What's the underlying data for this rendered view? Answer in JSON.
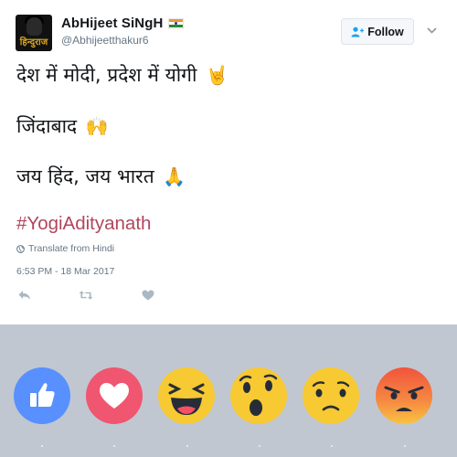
{
  "tweet": {
    "display_name": "AbHijeet SiNgH",
    "handle": "@Abhijeetthakur6",
    "avatar_logo_text": "हिन्दुराज",
    "follow_label": "Follow",
    "lines": [
      "देश में मोदी, प्रदेश में योगी",
      "जिंदाबाद",
      "जय हिंद, जय भारत"
    ],
    "line_emojis": [
      "🤘",
      "🙌",
      "🙏"
    ],
    "hashtag": "#YogiAdityanath",
    "translate_label": "Translate from Hindi",
    "timestamp": "6:53 PM - 18 Mar 2017"
  },
  "reactions": {
    "items": [
      "Like",
      "Love",
      "Haha",
      "Wow",
      "Sad",
      "Angry"
    ],
    "colors": {
      "like": "#5890ff",
      "love": "#f0566f",
      "face": "#f7c932",
      "angry_top": "#f2543c"
    }
  },
  "colors": {
    "hashtag": "#b0465c",
    "muted": "#657786",
    "reaction_bar": "#c1c7d1"
  }
}
